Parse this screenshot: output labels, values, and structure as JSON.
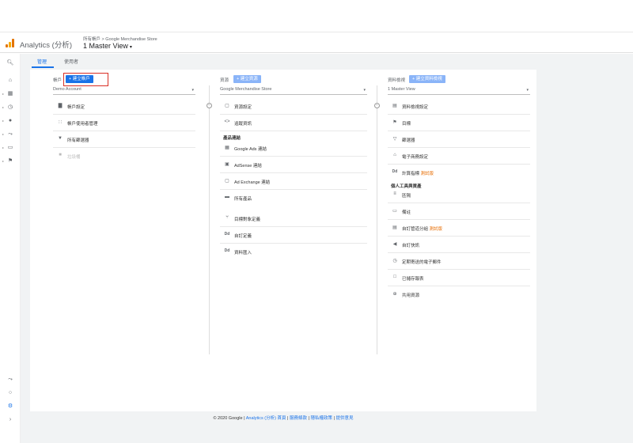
{
  "header": {
    "app_title": "Analytics (分析)",
    "breadcrumb_root": "所有帳戶",
    "breadcrumb_sep": ">",
    "breadcrumb_property": "Google Merchandise Store",
    "view_name": "1 Master View",
    "view_caret": "▾"
  },
  "tabs": [
    {
      "label": "管理"
    },
    {
      "label": "使用者"
    }
  ],
  "account_col": {
    "heading": "帳戶",
    "create_label": "+ 建立帳戶",
    "dropdown_value": "Demo Account",
    "items": [
      {
        "label": "帳戶設定",
        "icon": "building-icon"
      },
      {
        "label": "帳戶使用者管理",
        "icon": "users-icon"
      },
      {
        "label": "所有篩選器",
        "icon": "filter-icon"
      },
      {
        "label": "垃圾桶",
        "icon": "trash-icon"
      }
    ]
  },
  "property_col": {
    "heading": "資源",
    "create_label": "+ 建立資源",
    "dropdown_value": "Google Merchandise Store",
    "items": [
      {
        "label": "資源設定",
        "icon": "square-icon"
      },
      {
        "label": "追蹤資訊",
        "icon": "code-icon"
      }
    ],
    "section": "產品連結",
    "link_items": [
      {
        "label": "Google Ads 連結",
        "icon": "ads-icon"
      },
      {
        "label": "AdSense 連結",
        "icon": "adsense-icon"
      },
      {
        "label": "Ad Exchange 連結",
        "icon": "adexchange-icon"
      },
      {
        "label": "所有產品",
        "icon": "products-icon"
      }
    ],
    "bottom_items": [
      {
        "label": "目標對象定義",
        "icon": "audience-icon"
      },
      {
        "label": "自訂定義",
        "icon": "dd-icon",
        "glyph": "Dd"
      },
      {
        "label": "資料匯入",
        "icon": "dd-icon",
        "glyph": "Dd"
      }
    ]
  },
  "view_col": {
    "heading": "資料檢視",
    "create_label": "+ 建立資料檢視",
    "dropdown_value": "1 Master View",
    "items": [
      {
        "label": "資料檢視設定",
        "icon": "doc-icon"
      },
      {
        "label": "目標",
        "icon": "flag-icon"
      },
      {
        "label": "篩選器",
        "icon": "filter-icon"
      },
      {
        "label": "電子商務設定",
        "icon": "cart-icon"
      }
    ],
    "calc_item": {
      "label": "計算指標",
      "beta": "測試版",
      "glyph": "Dd"
    },
    "section": "個人工具與資產",
    "personal_items": [
      {
        "label": "區隔",
        "icon": "segments-icon"
      },
      {
        "label": "備註",
        "icon": "notes-icon"
      },
      {
        "label": "自訂管道分組",
        "beta": "測試版",
        "icon": "channel-icon"
      },
      {
        "label": "自訂快訊",
        "icon": "megaphone-icon"
      },
      {
        "label": "定期寄送的電子郵件",
        "icon": "clock-icon"
      },
      {
        "label": "已儲存報表",
        "icon": "saved-icon"
      },
      {
        "label": "共用資源",
        "icon": "share-icon"
      }
    ]
  },
  "footer": {
    "copyright": "© 2020 Google",
    "links": [
      "Analytics (分析) 首頁",
      "服務條款",
      "隱私權政策",
      "提供意見"
    ],
    "sep": "|"
  },
  "colors": {
    "accent": "#1a73e8",
    "highlight": "#d93025",
    "beta": "#e8710a"
  }
}
